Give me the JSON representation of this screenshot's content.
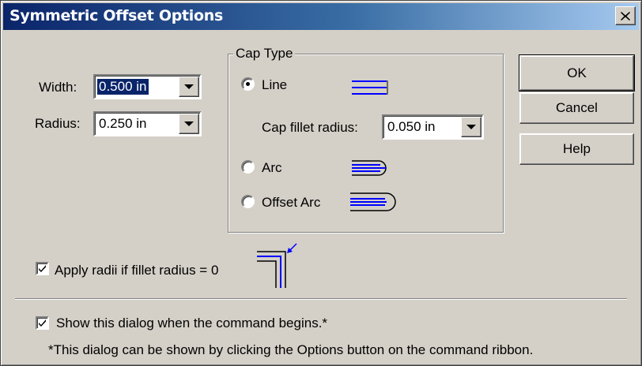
{
  "window": {
    "title": "Symmetric Offset Options",
    "close_icon": "close-x-icon"
  },
  "width": {
    "label": "Width:",
    "value": "0.500 in"
  },
  "radius": {
    "label": "Radius:",
    "value": "0.250 in"
  },
  "cap_type": {
    "group_label": "Cap Type",
    "options": [
      {
        "label": "Line",
        "selected": true,
        "icon": "cap-line-icon"
      },
      {
        "label": "Arc",
        "selected": false,
        "icon": "cap-arc-icon"
      },
      {
        "label": "Offset Arc",
        "selected": false,
        "icon": "cap-offset-arc-icon"
      }
    ],
    "cap_fillet": {
      "label": "Cap fillet radius:",
      "value": "0.050 in"
    }
  },
  "buttons": {
    "ok": "OK",
    "cancel": "Cancel",
    "help": "Help"
  },
  "apply_radii": {
    "label": "Apply radii if fillet radius = 0",
    "checked": true,
    "icon": "corner-fillet-icon"
  },
  "show_dialog": {
    "label": "Show this dialog when the command begins.*",
    "checked": true
  },
  "footnote": "*This dialog can be shown by clicking the Options button on the command ribbon.",
  "colors": {
    "titlebar_start": "#0a246a",
    "titlebar_end": "#a6caf0",
    "dialog_face": "#d4d0c8",
    "icon_blue": "#0000ff"
  }
}
